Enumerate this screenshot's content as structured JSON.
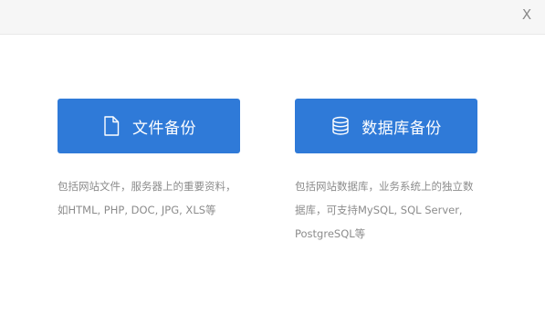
{
  "dialog": {
    "close_label": "X"
  },
  "options": {
    "file_backup": {
      "label": "文件备份",
      "icon": "file-icon",
      "desc_lines": [
        "包括网站文件，服务器上的重要资料，",
        "如HTML, PHP, DOC, JPG, XLS等"
      ]
    },
    "db_backup": {
      "label": "数据库备份",
      "icon": "database-icon",
      "desc_lines": [
        "包括网站数据库，业务系统上的独立数",
        "据库，可支持MySQL, SQL Server,",
        "PostgreSQL等"
      ]
    }
  },
  "colors": {
    "button_bg": "#2f7ad8",
    "button_text": "#ffffff",
    "desc_text": "#8c8c8c",
    "title_bar_bg": "#f6f6f6"
  }
}
